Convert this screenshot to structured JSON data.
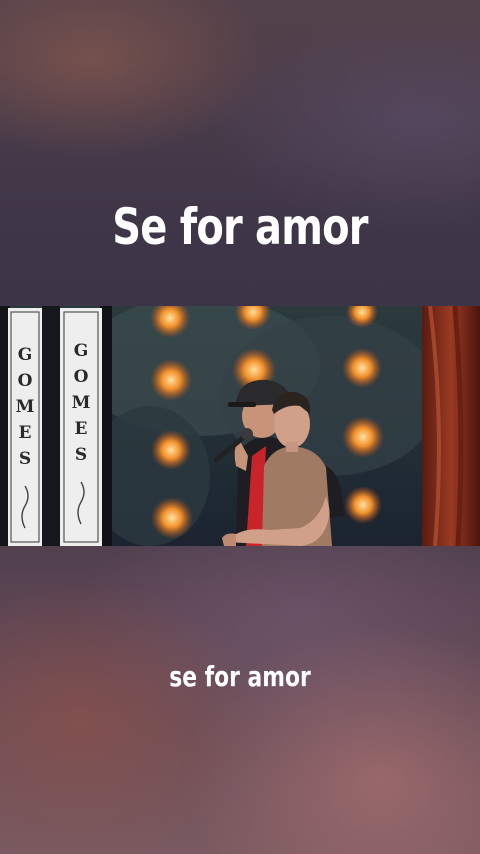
{
  "title": "Se for amor",
  "caption": "se for amor",
  "video": {
    "sign_left_letters": [
      "G",
      "O",
      "M",
      "E",
      "S"
    ],
    "sign_right_letters": [
      "G",
      "O",
      "M",
      "E",
      "S"
    ]
  }
}
